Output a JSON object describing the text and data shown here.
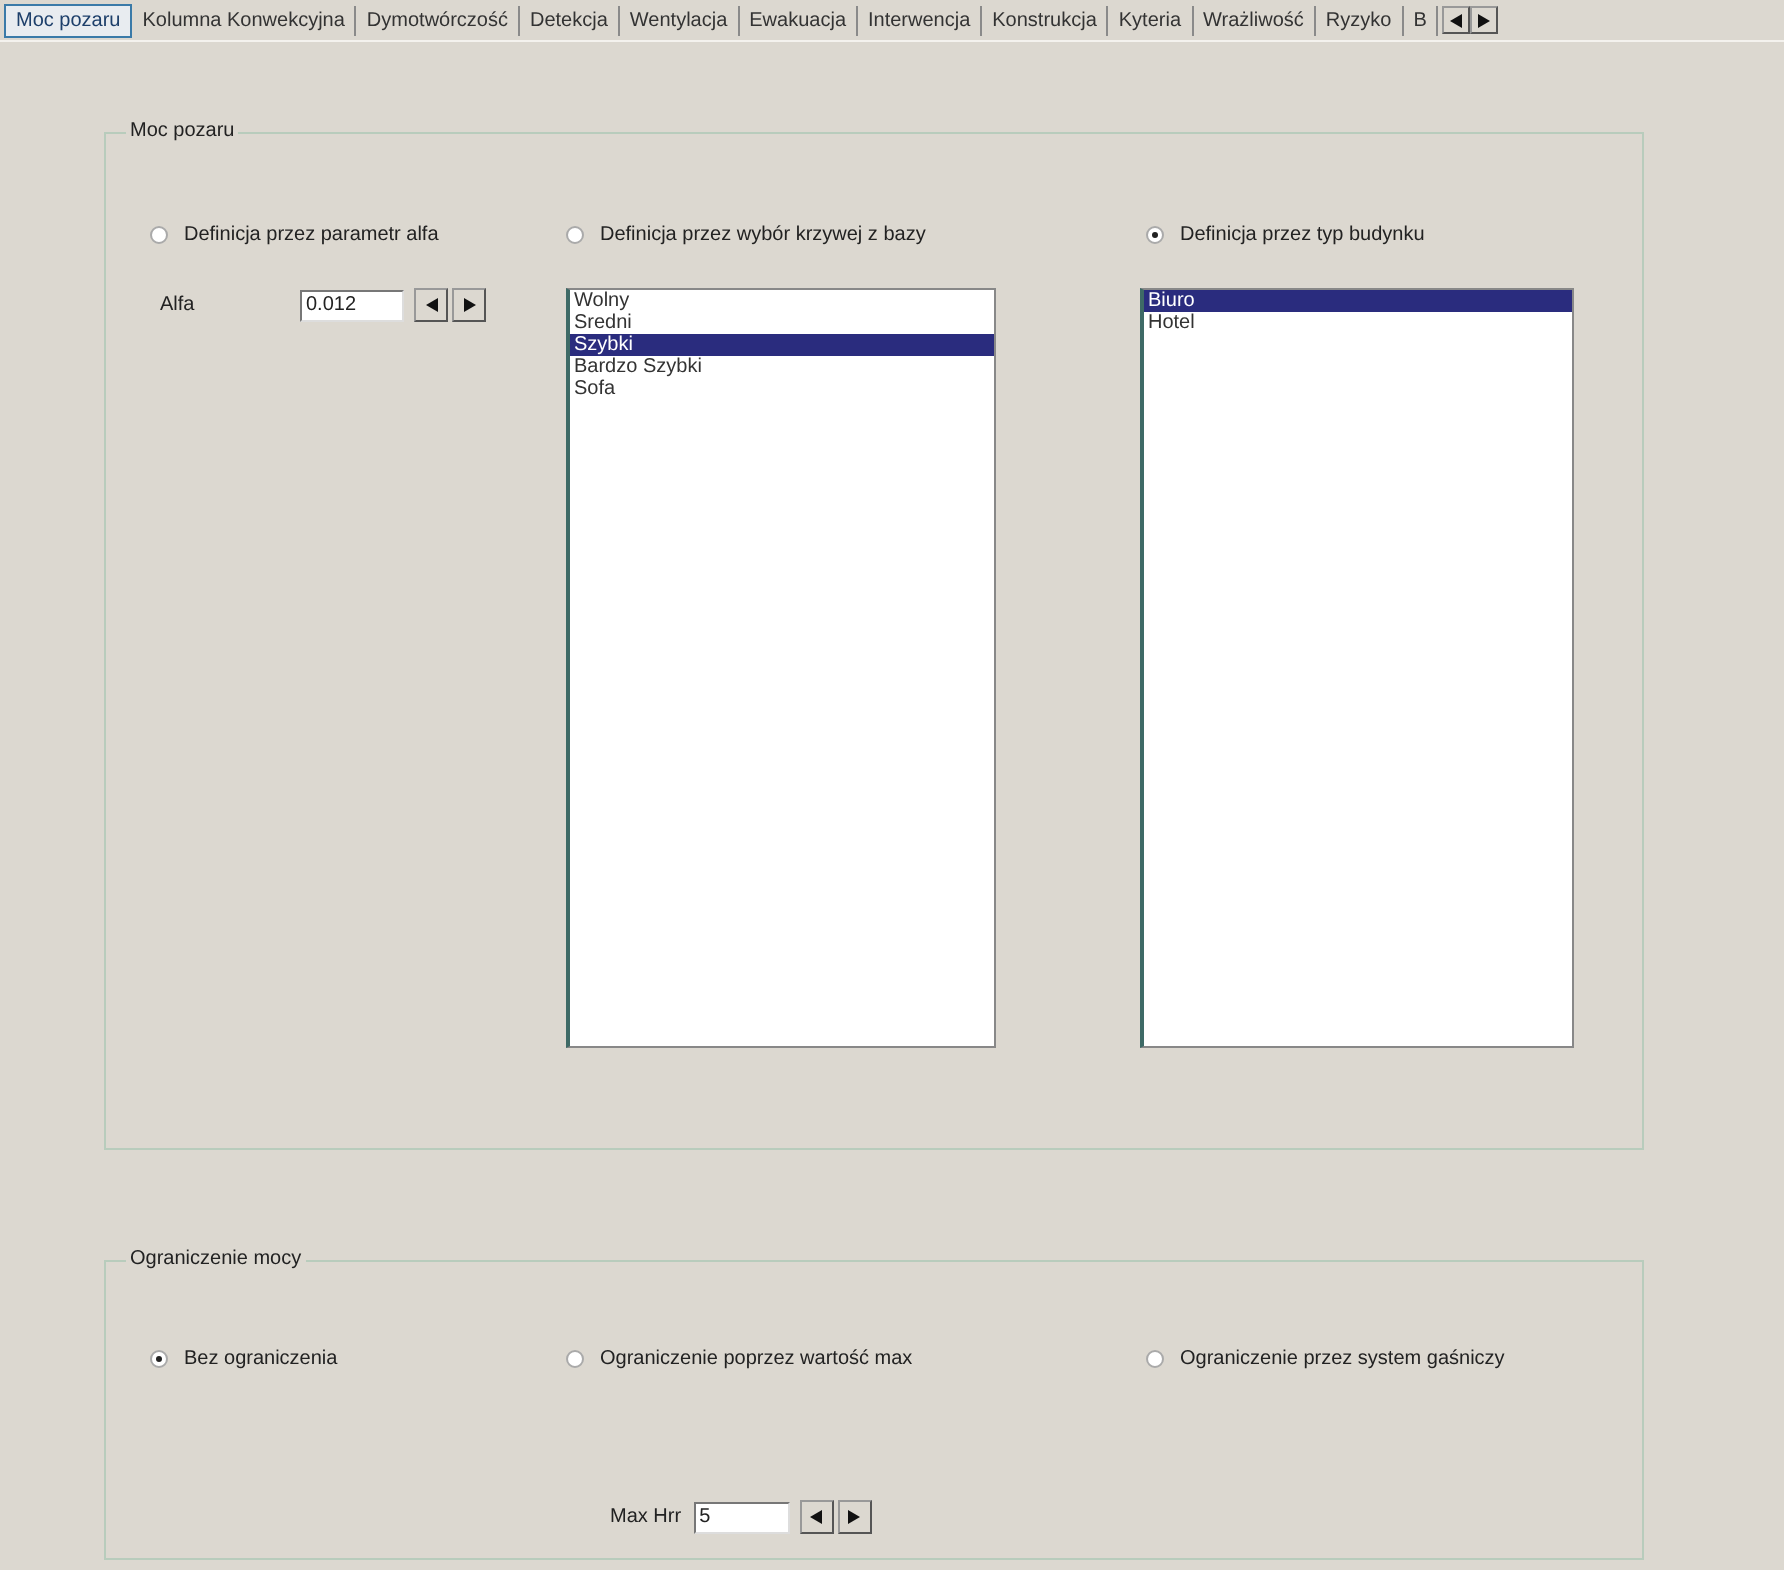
{
  "tabs": [
    {
      "label": "Moc pozaru",
      "selected": true
    },
    {
      "label": "Kolumna Konwekcyjna",
      "selected": false
    },
    {
      "label": "Dymotwórczość",
      "selected": false
    },
    {
      "label": "Detekcja",
      "selected": false
    },
    {
      "label": "Wentylacja",
      "selected": false
    },
    {
      "label": "Ewakuacja",
      "selected": false
    },
    {
      "label": "Interwencja",
      "selected": false
    },
    {
      "label": "Konstrukcja",
      "selected": false
    },
    {
      "label": "Kyteria",
      "selected": false
    },
    {
      "label": "Wrażliwość",
      "selected": false
    },
    {
      "label": "Ryzyko",
      "selected": false
    },
    {
      "label": "B",
      "selected": false
    }
  ],
  "fire_power": {
    "title": "Moc pozaru",
    "options": [
      {
        "label": "Definicja przez parametr alfa",
        "selected": false
      },
      {
        "label": "Definicja przez wybór krzywej z bazy",
        "selected": false
      },
      {
        "label": "Definicja przez typ budynku",
        "selected": true
      }
    ],
    "alfa": {
      "label": "Alfa",
      "value": "0.012"
    },
    "curve_list": [
      {
        "label": "Wolny",
        "selected": false
      },
      {
        "label": "Sredni",
        "selected": false
      },
      {
        "label": "Szybki",
        "selected": true
      },
      {
        "label": "Bardzo Szybki",
        "selected": false
      },
      {
        "label": "Sofa",
        "selected": false
      }
    ],
    "building_list": [
      {
        "label": "Biuro",
        "selected": true
      },
      {
        "label": "Hotel",
        "selected": false
      }
    ]
  },
  "power_limit": {
    "title": "Ograniczenie mocy",
    "options": [
      {
        "label": "Bez ograniczenia",
        "selected": true
      },
      {
        "label": "Ograniczenie poprzez wartość max",
        "selected": false
      },
      {
        "label": "Ograniczenie przez system gaśniczy",
        "selected": false
      }
    ],
    "max_hrr": {
      "label": "Max Hrr",
      "value": "5"
    }
  }
}
